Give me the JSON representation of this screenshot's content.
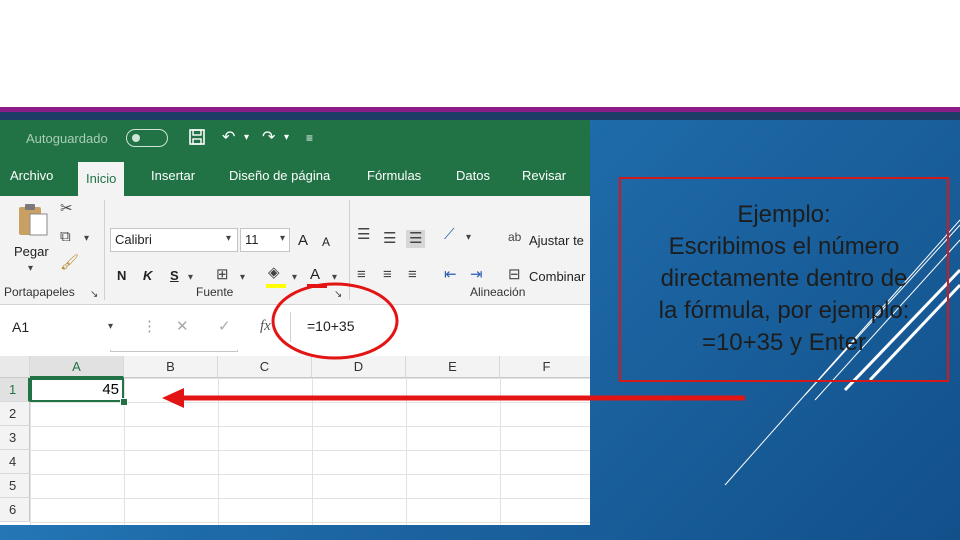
{
  "titlebar": {
    "autosave_label": "Autoguardado"
  },
  "tabs": [
    "Archivo",
    "Inicio",
    "Insertar",
    "Diseño de página",
    "Fórmulas",
    "Datos",
    "Revisar"
  ],
  "ribbon": {
    "paste_label": "Pegar",
    "font_name": "Calibri",
    "font_size": "11",
    "grow_font": "A",
    "shrink_font": "A",
    "bold": "N",
    "italic": "K",
    "underline": "S",
    "wrap_text": "Ajustar te",
    "merge": "Combinar",
    "group_clipboard": "Portapapeles",
    "group_font": "Fuente",
    "group_alignment": "Alineación"
  },
  "formula_bar": {
    "name_box": "A1",
    "fx": "fx",
    "formula": "=10+35"
  },
  "grid": {
    "columns": [
      "A",
      "B",
      "C",
      "D",
      "E",
      "F"
    ],
    "rows": [
      "1",
      "2",
      "3",
      "4",
      "5",
      "6"
    ],
    "active_cell_value": "45"
  },
  "callout": {
    "lines": [
      "Ejemplo:",
      "Escribimos el número",
      "directamente dentro de",
      "la fórmula, por ejemplo:",
      "=10+35 y Enter"
    ]
  },
  "colors": {
    "excel_green": "#217346",
    "highlight_red": "#e31414",
    "panel_blue": "#1e6aa8"
  }
}
